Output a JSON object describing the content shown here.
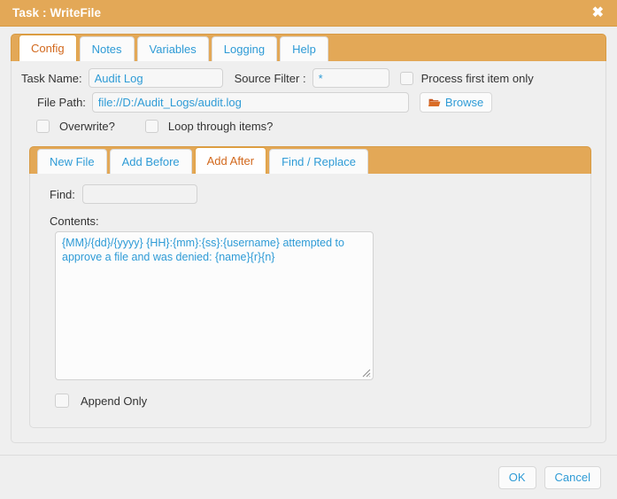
{
  "window": {
    "title": "Task : WriteFile",
    "close_icon": "close-icon",
    "close_glyph": "✖",
    "accent_color": "#e3a857",
    "link_color": "#2e9bd6",
    "active_tab_color": "#d2691e"
  },
  "outer_tabs": [
    {
      "label": "Config",
      "active": true
    },
    {
      "label": "Notes",
      "active": false
    },
    {
      "label": "Variables",
      "active": false
    },
    {
      "label": "Logging",
      "active": false
    },
    {
      "label": "Help",
      "active": false
    }
  ],
  "config": {
    "task_name": {
      "label": "Task Name:",
      "value": "Audit Log",
      "placeholder": ""
    },
    "source_filter": {
      "label": "Source Filter :",
      "value": "*",
      "placeholder": ""
    },
    "process_first_item_only": {
      "label": "Process first item only",
      "checked": false
    },
    "file_path": {
      "label": "File Path:",
      "value": "file://D:/Audit_Logs/audit.log",
      "placeholder": ""
    },
    "browse_button": {
      "label": "Browse",
      "icon": "folder-open-icon"
    },
    "overwrite": {
      "label": "Overwrite?",
      "checked": false
    },
    "loop_through_items": {
      "label": "Loop through items?",
      "checked": false
    }
  },
  "inner_tabs": [
    {
      "label": "New File",
      "active": false
    },
    {
      "label": "Add Before",
      "active": false
    },
    {
      "label": "Add After",
      "active": true
    },
    {
      "label": "Find / Replace",
      "active": false
    }
  ],
  "inner_panel": {
    "find": {
      "label": "Find:",
      "value": "",
      "placeholder": ""
    },
    "contents": {
      "label": "Contents:",
      "value": "{MM}/{dd}/{yyyy} {HH}:{mm}:{ss}:{username} attempted to approve a file and was denied: {name}{r}{n}",
      "placeholder": ""
    },
    "append_only": {
      "label": "Append Only",
      "checked": false
    }
  },
  "footer": {
    "ok_label": "OK",
    "cancel_label": "Cancel"
  }
}
